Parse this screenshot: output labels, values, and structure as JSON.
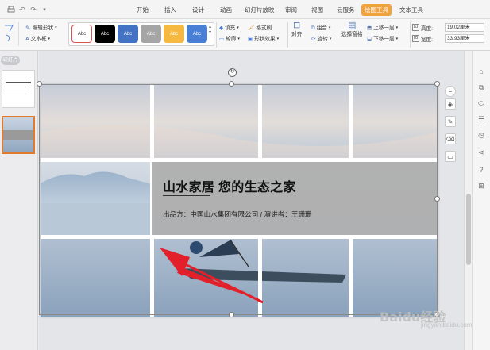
{
  "quick_access": [
    "print-icon",
    "undo-icon",
    "redo-icon",
    "more-icon"
  ],
  "menu_tabs": [
    {
      "label": "开始"
    },
    {
      "label": "插入"
    },
    {
      "label": "设计"
    },
    {
      "label": "动画"
    },
    {
      "label": "幻灯片放映"
    },
    {
      "label": "审阅"
    },
    {
      "label": "视图"
    },
    {
      "label": "云服务"
    },
    {
      "label": "绘图工具",
      "active": true
    },
    {
      "label": "文本工具"
    }
  ],
  "ribbon": {
    "edit_shape": "编辑形状",
    "text_box": "文本框",
    "style_label": "Abc",
    "fill": "填充",
    "format_painter": "格式刷",
    "outline": "轮廓",
    "shape_effects": "形状效果",
    "align": "对齐",
    "group": "组合",
    "rotate": "旋转",
    "selection_pane": "选择窗格",
    "bring_forward": "上移一层",
    "send_backward": "下移一层",
    "height_label": "高度:",
    "height_value": "19.02厘米",
    "width_label": "宽度:",
    "width_value": "33.93厘米"
  },
  "style_colors": [
    "#ffffff",
    "#000000",
    "#4472c4",
    "#a5a5a5",
    "#f5b942",
    "#4a7fd6"
  ],
  "left_panel": {
    "tab_label": "幻灯片"
  },
  "slide": {
    "title": "山水家居 您的生态之家",
    "subtitle": "出品方：中国山水集团有限公司 / 演讲者：王珊珊"
  },
  "colors": {
    "accent": "#f0a23d",
    "arrow": "#e3202a",
    "banner": "#afafaf"
  },
  "watermark": {
    "brand": "Baidu经验",
    "sub": "jingyan.baidu.com"
  }
}
